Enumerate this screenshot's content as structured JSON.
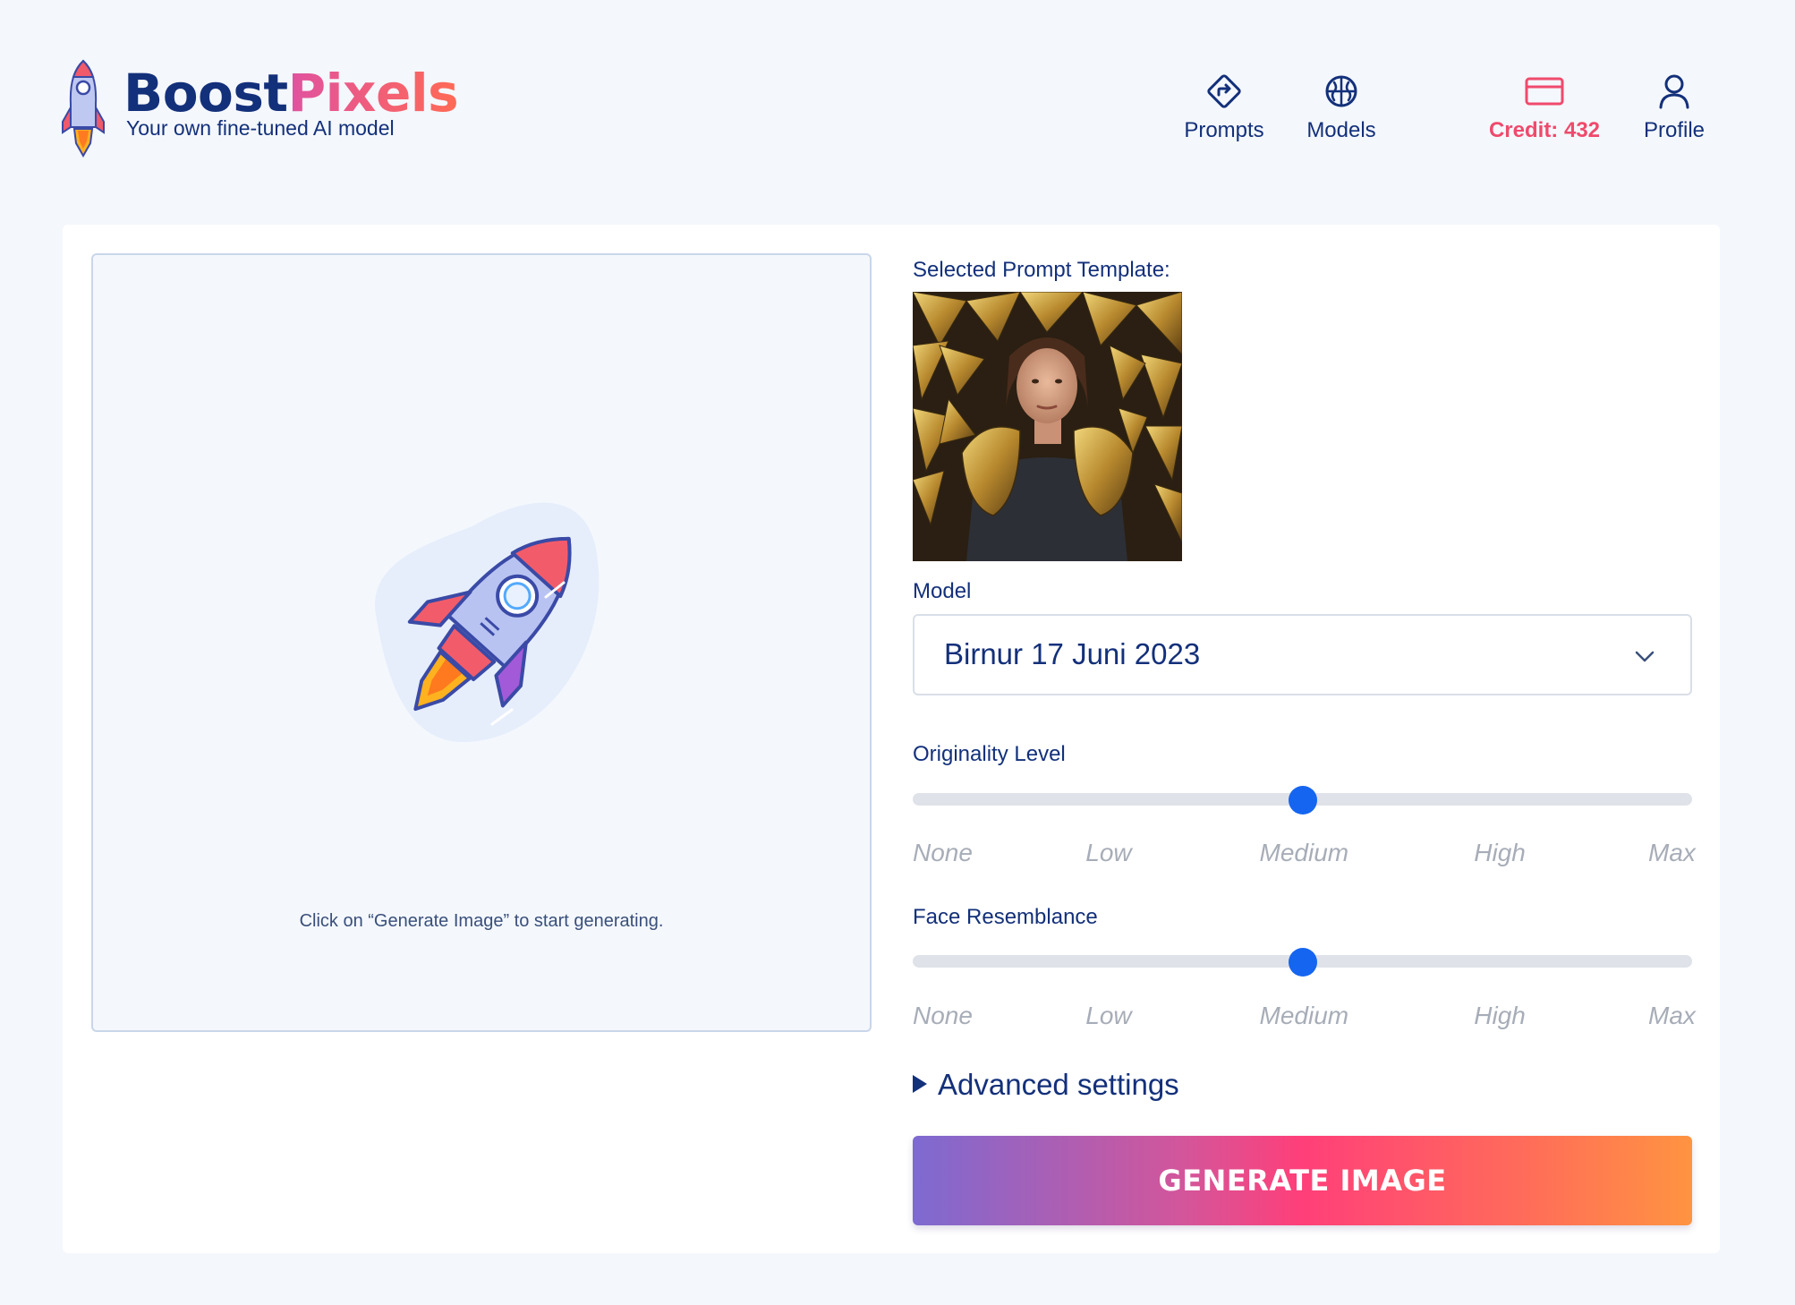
{
  "brand": {
    "name_part1": "Boost",
    "name_part2": "Pixels",
    "tagline": "Your own fine-tuned AI model"
  },
  "nav": {
    "prompts": {
      "label": "Prompts",
      "icon": "directions-sign-icon"
    },
    "models": {
      "label": "Models",
      "icon": "brain-icon"
    },
    "credit": {
      "label": "Credit: 432",
      "icon": "credit-card-icon"
    },
    "profile": {
      "label": "Profile",
      "icon": "user-icon"
    }
  },
  "preview": {
    "illustration": "rocket-icon",
    "hint": "Click on “Generate Image” to start generating."
  },
  "form": {
    "template_label": "Selected Prompt Template:",
    "model_label": "Model",
    "model_value": "Birnur 17 Juni 2023",
    "originality": {
      "label": "Originality Level",
      "value": 0.5
    },
    "resemblance": {
      "label": "Face Resemblance",
      "value": 0.5
    },
    "scale": [
      "None",
      "Low",
      "Medium",
      "High",
      "Max"
    ],
    "advanced_label": "Advanced settings",
    "generate_label": "GENERATE IMAGE"
  },
  "colors": {
    "primary_text": "#13307a",
    "accent": "#ef4a6c",
    "slider_thumb": "#1565f0",
    "background": "#f4f7fc"
  }
}
